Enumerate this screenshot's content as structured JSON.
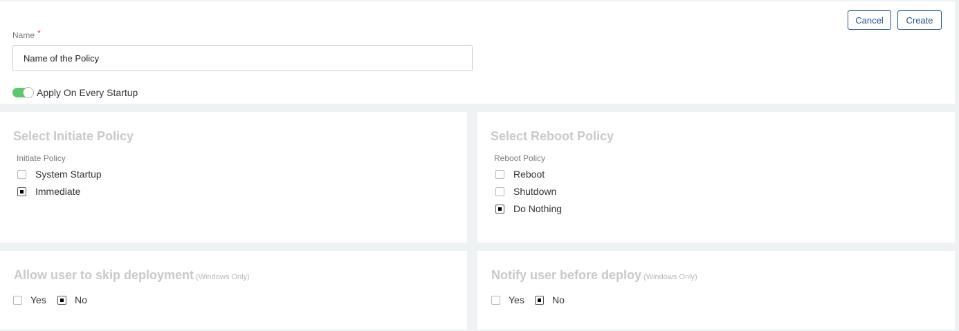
{
  "header": {
    "name_label": "Name",
    "required_marker": "*",
    "name_value": "Name of the Policy",
    "apply_on_startup": {
      "label": "Apply On Every Startup",
      "enabled": true
    },
    "cancel_label": "Cancel",
    "create_label": "Create"
  },
  "initiate": {
    "title": "Select Initiate Policy",
    "group_label": "Initiate Policy",
    "options": [
      {
        "label": "System Startup",
        "checked": false
      },
      {
        "label": "Immediate",
        "checked": true
      }
    ]
  },
  "reboot": {
    "title": "Select Reboot Policy",
    "group_label": "Reboot Policy",
    "options": [
      {
        "label": "Reboot",
        "checked": false
      },
      {
        "label": "Shutdown",
        "checked": false
      },
      {
        "label": "Do Nothing",
        "checked": true
      }
    ]
  },
  "skip": {
    "title": "Allow user to skip deployment",
    "note": "(Windows Only)",
    "options": [
      {
        "label": "Yes",
        "checked": false
      },
      {
        "label": "No",
        "checked": true
      }
    ]
  },
  "notify": {
    "title": "Notify user before deploy",
    "note": "(Windows Only)",
    "options": [
      {
        "label": "Yes",
        "checked": false
      },
      {
        "label": "No",
        "checked": true
      }
    ]
  },
  "colors": {
    "accent": "#1e4f8f",
    "toggle_on": "#5cc76e",
    "background": "#eef2f3",
    "muted_title": "#c7c9cb"
  }
}
